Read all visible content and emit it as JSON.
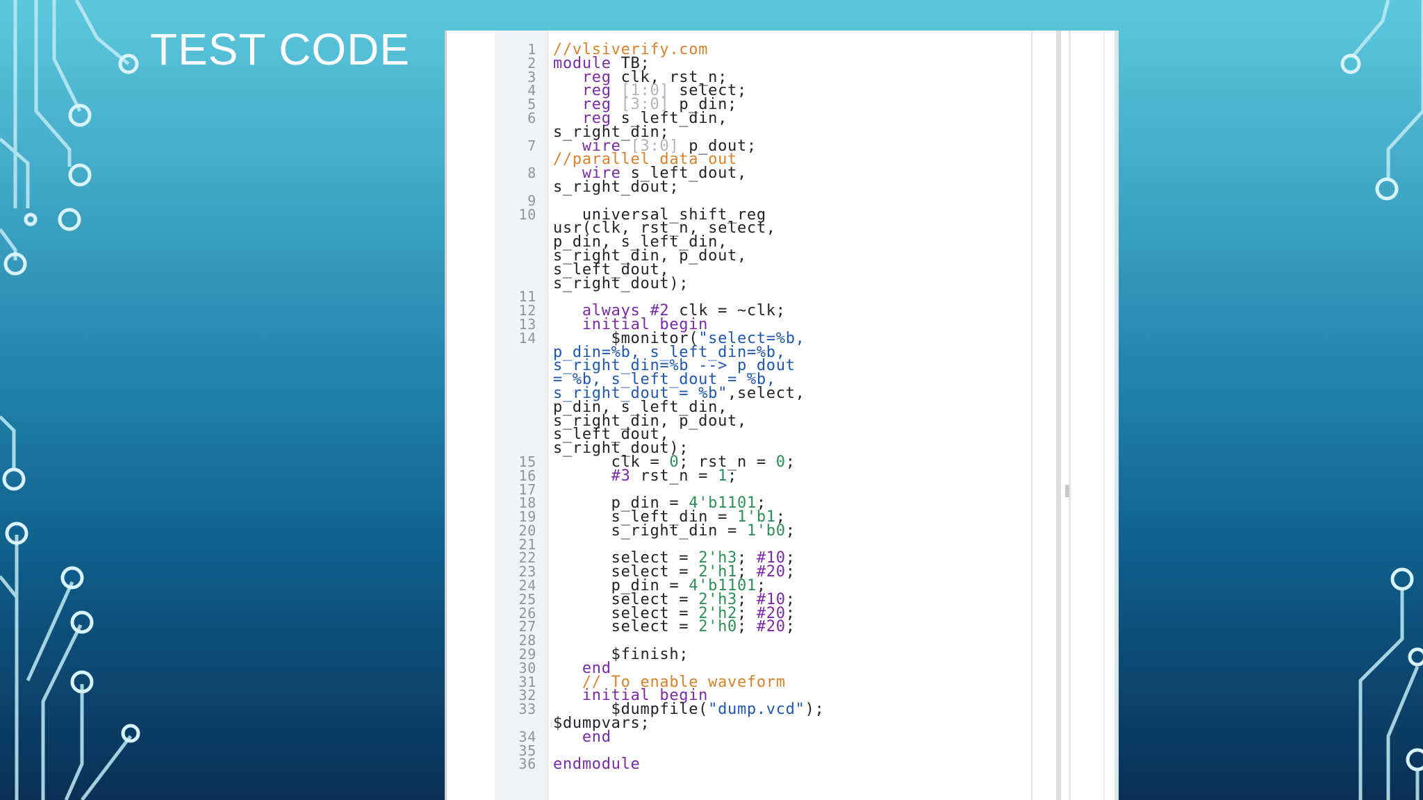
{
  "slide": {
    "title": "TEST CODE"
  },
  "code_lines": [
    {
      "n": "1",
      "tokens": [
        {
          "t": "//vlsiverify.com",
          "c": "comment"
        }
      ]
    },
    {
      "n": "2",
      "tokens": [
        {
          "t": "module",
          "c": "kw"
        },
        {
          "t": " TB;",
          "c": ""
        }
      ]
    },
    {
      "n": "3",
      "tokens": [
        {
          "t": "   ",
          "c": ""
        },
        {
          "t": "reg",
          "c": "kw"
        },
        {
          "t": " clk, rst_n;",
          "c": ""
        }
      ]
    },
    {
      "n": "4",
      "tokens": [
        {
          "t": "   ",
          "c": ""
        },
        {
          "t": "reg",
          "c": "kw"
        },
        {
          "t": " ",
          "c": ""
        },
        {
          "t": "[1:0]",
          "c": "op"
        },
        {
          "t": " select;",
          "c": ""
        }
      ]
    },
    {
      "n": "5",
      "tokens": [
        {
          "t": "   ",
          "c": ""
        },
        {
          "t": "reg",
          "c": "kw"
        },
        {
          "t": " ",
          "c": ""
        },
        {
          "t": "[3:0]",
          "c": "op"
        },
        {
          "t": " p_din;",
          "c": ""
        }
      ]
    },
    {
      "n": "6",
      "tokens": [
        {
          "t": "   ",
          "c": ""
        },
        {
          "t": "reg",
          "c": "kw"
        },
        {
          "t": " s_left_din,\ns_right_din;",
          "c": ""
        }
      ]
    },
    {
      "n": "7",
      "tokens": [
        {
          "t": "   ",
          "c": ""
        },
        {
          "t": "wire",
          "c": "kw"
        },
        {
          "t": " ",
          "c": ""
        },
        {
          "t": "[3:0]",
          "c": "op"
        },
        {
          "t": " p_dout;\n",
          "c": ""
        },
        {
          "t": "//parallel data out",
          "c": "comment"
        }
      ]
    },
    {
      "n": "8",
      "tokens": [
        {
          "t": "   ",
          "c": ""
        },
        {
          "t": "wire",
          "c": "kw"
        },
        {
          "t": " s_left_dout,\ns_right_dout;",
          "c": ""
        }
      ]
    },
    {
      "n": "9",
      "tokens": []
    },
    {
      "n": "10",
      "tokens": [
        {
          "t": "   universal_shift_reg\nusr(clk, rst_n, select,\np_din, s_left_din,\ns_right_din, p_dout,\ns_left_dout,\ns_right_dout);",
          "c": ""
        }
      ]
    },
    {
      "n": "11",
      "tokens": []
    },
    {
      "n": "12",
      "tokens": [
        {
          "t": "   ",
          "c": ""
        },
        {
          "t": "always",
          "c": "kw"
        },
        {
          "t": " ",
          "c": ""
        },
        {
          "t": "#2",
          "c": "kw"
        },
        {
          "t": " clk = ~clk;",
          "c": ""
        }
      ]
    },
    {
      "n": "13",
      "tokens": [
        {
          "t": "   ",
          "c": ""
        },
        {
          "t": "initial begin",
          "c": "kw"
        }
      ]
    },
    {
      "n": "14",
      "tokens": [
        {
          "t": "      $monitor(",
          "c": ""
        },
        {
          "t": "\"select=%b,\np_din=%b, s_left_din=%b,\ns_right_din=%b --> p_dout\n= %b, s_left_dout = %b,\ns_right_dout = %b\"",
          "c": "str"
        },
        {
          "t": ",select,\np_din, s_left_din,\ns_right_din, p_dout,\ns_left_dout,\ns_right_dout);",
          "c": ""
        }
      ]
    },
    {
      "n": "15",
      "tokens": [
        {
          "t": "      clk = ",
          "c": ""
        },
        {
          "t": "0",
          "c": "num"
        },
        {
          "t": "; rst_n = ",
          "c": ""
        },
        {
          "t": "0",
          "c": "num"
        },
        {
          "t": ";",
          "c": ""
        }
      ]
    },
    {
      "n": "16",
      "tokens": [
        {
          "t": "      ",
          "c": ""
        },
        {
          "t": "#3",
          "c": "kw"
        },
        {
          "t": " rst_n = ",
          "c": ""
        },
        {
          "t": "1",
          "c": "num"
        },
        {
          "t": ";",
          "c": ""
        }
      ]
    },
    {
      "n": "17",
      "tokens": []
    },
    {
      "n": "18",
      "tokens": [
        {
          "t": "      p_din = ",
          "c": ""
        },
        {
          "t": "4'b1101",
          "c": "num"
        },
        {
          "t": ";",
          "c": ""
        }
      ]
    },
    {
      "n": "19",
      "tokens": [
        {
          "t": "      s_left_din = ",
          "c": ""
        },
        {
          "t": "1'b1",
          "c": "num"
        },
        {
          "t": ";",
          "c": ""
        }
      ]
    },
    {
      "n": "20",
      "tokens": [
        {
          "t": "      s_right_din = ",
          "c": ""
        },
        {
          "t": "1'b0",
          "c": "num"
        },
        {
          "t": ";",
          "c": ""
        }
      ]
    },
    {
      "n": "21",
      "tokens": []
    },
    {
      "n": "22",
      "tokens": [
        {
          "t": "      select = ",
          "c": ""
        },
        {
          "t": "2'h3",
          "c": "num"
        },
        {
          "t": "; ",
          "c": ""
        },
        {
          "t": "#10",
          "c": "kw"
        },
        {
          "t": ";",
          "c": ""
        }
      ]
    },
    {
      "n": "23",
      "tokens": [
        {
          "t": "      select = ",
          "c": ""
        },
        {
          "t": "2'h1",
          "c": "num"
        },
        {
          "t": "; ",
          "c": ""
        },
        {
          "t": "#20",
          "c": "kw"
        },
        {
          "t": ";",
          "c": ""
        }
      ]
    },
    {
      "n": "24",
      "tokens": [
        {
          "t": "      p_din = ",
          "c": ""
        },
        {
          "t": "4'b1101",
          "c": "num"
        },
        {
          "t": ";",
          "c": ""
        }
      ]
    },
    {
      "n": "25",
      "tokens": [
        {
          "t": "      select = ",
          "c": ""
        },
        {
          "t": "2'h3",
          "c": "num"
        },
        {
          "t": "; ",
          "c": ""
        },
        {
          "t": "#10",
          "c": "kw"
        },
        {
          "t": ";",
          "c": ""
        }
      ]
    },
    {
      "n": "26",
      "tokens": [
        {
          "t": "      select = ",
          "c": ""
        },
        {
          "t": "2'h2",
          "c": "num"
        },
        {
          "t": "; ",
          "c": ""
        },
        {
          "t": "#20",
          "c": "kw"
        },
        {
          "t": ";",
          "c": ""
        }
      ]
    },
    {
      "n": "27",
      "tokens": [
        {
          "t": "      select = ",
          "c": ""
        },
        {
          "t": "2'h0",
          "c": "num"
        },
        {
          "t": "; ",
          "c": ""
        },
        {
          "t": "#20",
          "c": "kw"
        },
        {
          "t": ";",
          "c": ""
        }
      ]
    },
    {
      "n": "28",
      "tokens": []
    },
    {
      "n": "29",
      "tokens": [
        {
          "t": "      $finish;",
          "c": ""
        }
      ]
    },
    {
      "n": "30",
      "tokens": [
        {
          "t": "   ",
          "c": ""
        },
        {
          "t": "end",
          "c": "kw"
        }
      ]
    },
    {
      "n": "31",
      "tokens": [
        {
          "t": "   ",
          "c": ""
        },
        {
          "t": "// To enable waveform",
          "c": "comment"
        }
      ]
    },
    {
      "n": "32",
      "tokens": [
        {
          "t": "   ",
          "c": ""
        },
        {
          "t": "initial begin",
          "c": "kw"
        }
      ]
    },
    {
      "n": "33",
      "tokens": [
        {
          "t": "      $dumpfile(",
          "c": ""
        },
        {
          "t": "\"dump.vcd\"",
          "c": "str"
        },
        {
          "t": ");\n$dumpvars;",
          "c": ""
        }
      ]
    },
    {
      "n": "34",
      "tokens": [
        {
          "t": "   ",
          "c": ""
        },
        {
          "t": "end",
          "c": "kw"
        }
      ]
    },
    {
      "n": "35",
      "tokens": []
    },
    {
      "n": "36",
      "tokens": [
        {
          "t": "endmodule",
          "c": "kw"
        }
      ]
    }
  ]
}
